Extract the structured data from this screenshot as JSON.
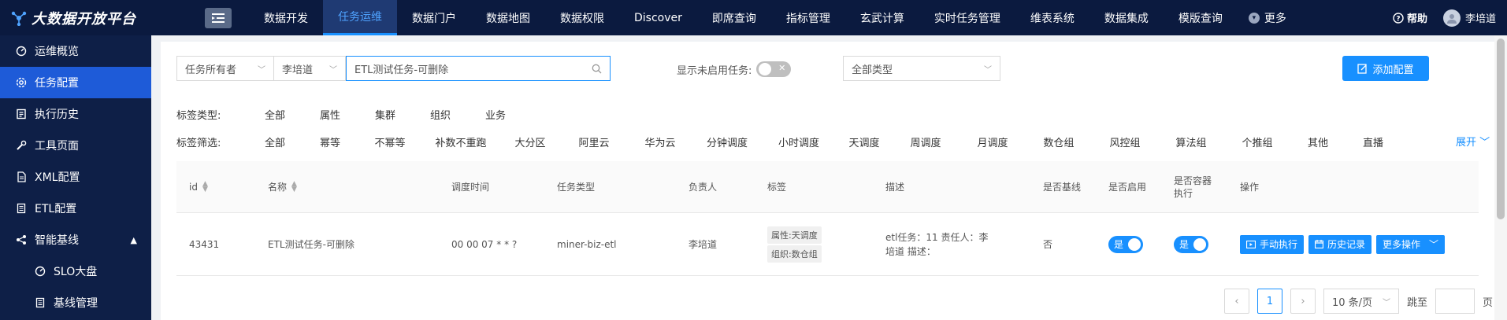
{
  "brand": {
    "title": "大数据开放平台"
  },
  "nav": {
    "items": [
      {
        "label": "数据开发"
      },
      {
        "label": "任务运维"
      },
      {
        "label": "数据门户"
      },
      {
        "label": "数据地图"
      },
      {
        "label": "数据权限"
      },
      {
        "label": "Discover"
      },
      {
        "label": "即席查询"
      },
      {
        "label": "指标管理"
      },
      {
        "label": "玄武计算"
      },
      {
        "label": "实时任务管理"
      },
      {
        "label": "维表系统"
      },
      {
        "label": "数据集成"
      },
      {
        "label": "模版查询"
      }
    ],
    "active_index": 1,
    "more_label": "更多",
    "help_label": "帮助",
    "user_name": "李培道"
  },
  "sidebar": {
    "items": [
      {
        "label": "运维概览",
        "icon": "dashboard-icon"
      },
      {
        "label": "任务配置",
        "icon": "settings-icon"
      },
      {
        "label": "执行历史",
        "icon": "history-icon"
      },
      {
        "label": "工具页面",
        "icon": "wrench-icon"
      },
      {
        "label": "XML配置",
        "icon": "document-icon"
      },
      {
        "label": "ETL配置",
        "icon": "list-icon"
      },
      {
        "label": "智能基线",
        "icon": "share-icon"
      },
      {
        "label": "SLO大盘",
        "icon": "gauge-icon"
      },
      {
        "label": "基线管理",
        "icon": "list-icon"
      }
    ]
  },
  "filters": {
    "owner_type": "任务所有者",
    "owner": "李培道",
    "search_value": "ETL测试任务-可删除",
    "show_disabled_label": "显示未启用任务:",
    "task_type": "全部类型",
    "add_button": "添加配置"
  },
  "tag_type": {
    "label": "标签类型:",
    "options": [
      "全部",
      "属性",
      "集群",
      "组织",
      "业务"
    ]
  },
  "tag_filter": {
    "label": "标签筛选:",
    "options": [
      "全部",
      "幂等",
      "不幂等",
      "补数不重跑",
      "大分区",
      "阿里云",
      "华为云",
      "分钟调度",
      "小时调度",
      "天调度",
      "周调度",
      "月调度",
      "数仓组",
      "风控组",
      "算法组",
      "个推组",
      "其他",
      "直播"
    ],
    "expand_label": "展开"
  },
  "table": {
    "headers": {
      "id": "id",
      "name": "名称",
      "schedule": "调度时间",
      "task_type": "任务类型",
      "owner": "负责人",
      "tags": "标签",
      "desc": "描述",
      "baseline": "是否基线",
      "enabled": "是否启用",
      "container": "是否容器执行",
      "ops": "操作"
    },
    "rows": [
      {
        "id": "43431",
        "name": "ETL测试任务-可删除",
        "schedule": "00 00 07 * * ?",
        "task_type": "miner-biz-etl",
        "owner": "李培道",
        "tag1": "属性:天调度",
        "tag2": "组织:数仓组",
        "desc": "etl任务：11 责任人：李培道 描述：",
        "baseline": "否",
        "enabled": "是",
        "container": "是"
      }
    ],
    "ops": {
      "run": "手动执行",
      "history": "历史记录",
      "more": "更多操作"
    }
  },
  "pagination": {
    "current": "1",
    "page_size": "10 条/页",
    "jump_label": "跳至",
    "page_unit": "页"
  },
  "colors": {
    "primary": "#1890ff",
    "topbar": "#0b1a3f",
    "sidebar": "#0e1f47",
    "sidebar_active": "#1e5bd8"
  }
}
